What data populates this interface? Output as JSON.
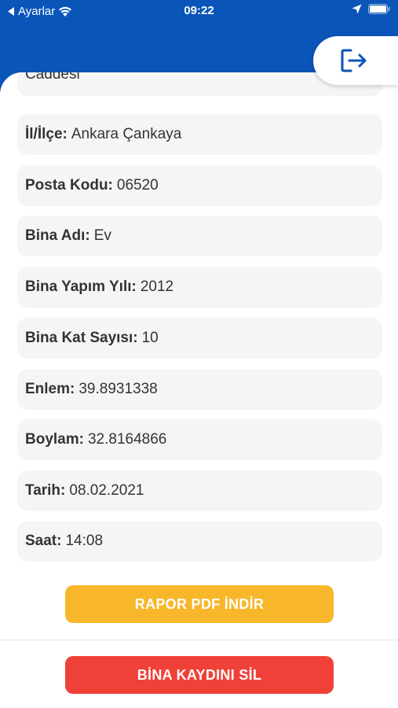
{
  "status_bar": {
    "carrier": "Ayarlar",
    "time": "09:22"
  },
  "header": {
    "logout_icon": "logout-icon",
    "color": "#0a55b8"
  },
  "details": [
    {
      "label": "",
      "value": "Caddesi"
    },
    {
      "label": "İl/İlçe:",
      "value": "Ankara Çankaya"
    },
    {
      "label": "Posta Kodu:",
      "value": "06520"
    },
    {
      "label": "Bina Adı:",
      "value": "Ev"
    },
    {
      "label": "Bina Yapım Yılı:",
      "value": "2012"
    },
    {
      "label": "Bina Kat Sayısı:",
      "value": "10"
    },
    {
      "label": "Enlem:",
      "value": "39.8931338"
    },
    {
      "label": "Boylam:",
      "value": "32.8164866"
    },
    {
      "label": "Tarih:",
      "value": "08.02.2021"
    },
    {
      "label": "Saat:",
      "value": "14:08"
    }
  ],
  "actions": {
    "pdf_label": "RAPOR PDF İNDİR",
    "pdf_color": "#f8b72b",
    "delete_label": "BİNA KAYDINI SİL",
    "delete_color": "#f04138"
  }
}
